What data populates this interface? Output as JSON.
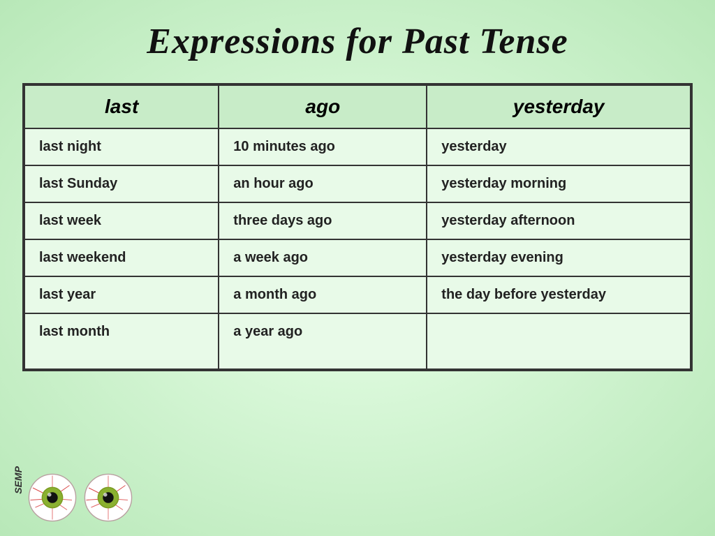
{
  "title": "Expressions for Past Tense",
  "table": {
    "headers": [
      "last",
      "ago",
      "yesterday"
    ],
    "rows": [
      [
        "last night",
        "10 minutes ago",
        "yesterday"
      ],
      [
        "last Sunday",
        "an hour ago",
        "yesterday morning"
      ],
      [
        "last week",
        "three days ago",
        "yesterday afternoon"
      ],
      [
        "last weekend",
        "a week ago",
        "yesterday evening"
      ],
      [
        "last year",
        "a month ago",
        "the day before yesterday"
      ],
      [
        "last month",
        "a year ago",
        ""
      ]
    ]
  },
  "watermark": "SEMP"
}
